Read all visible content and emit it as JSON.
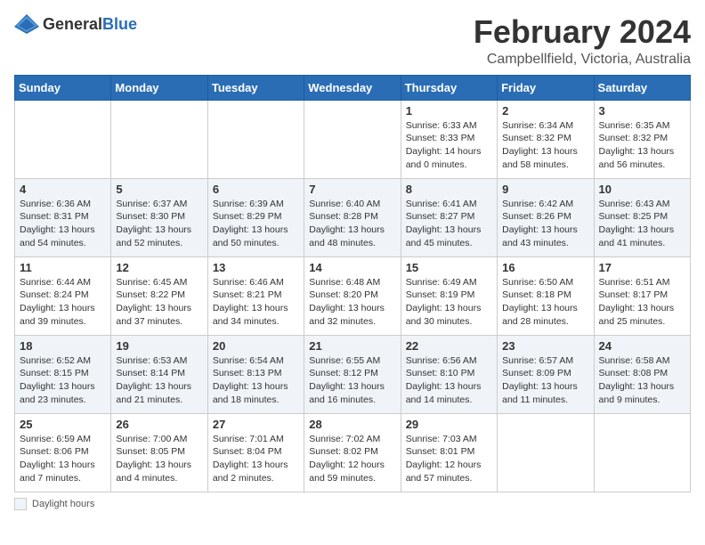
{
  "logo": {
    "text_general": "General",
    "text_blue": "Blue"
  },
  "header": {
    "month": "February 2024",
    "location": "Campbellfield, Victoria, Australia"
  },
  "days_of_week": [
    "Sunday",
    "Monday",
    "Tuesday",
    "Wednesday",
    "Thursday",
    "Friday",
    "Saturday"
  ],
  "weeks": [
    [
      {
        "num": "",
        "info": ""
      },
      {
        "num": "",
        "info": ""
      },
      {
        "num": "",
        "info": ""
      },
      {
        "num": "",
        "info": ""
      },
      {
        "num": "1",
        "info": "Sunrise: 6:33 AM\nSunset: 8:33 PM\nDaylight: 14 hours\nand 0 minutes."
      },
      {
        "num": "2",
        "info": "Sunrise: 6:34 AM\nSunset: 8:32 PM\nDaylight: 13 hours\nand 58 minutes."
      },
      {
        "num": "3",
        "info": "Sunrise: 6:35 AM\nSunset: 8:32 PM\nDaylight: 13 hours\nand 56 minutes."
      }
    ],
    [
      {
        "num": "4",
        "info": "Sunrise: 6:36 AM\nSunset: 8:31 PM\nDaylight: 13 hours\nand 54 minutes."
      },
      {
        "num": "5",
        "info": "Sunrise: 6:37 AM\nSunset: 8:30 PM\nDaylight: 13 hours\nand 52 minutes."
      },
      {
        "num": "6",
        "info": "Sunrise: 6:39 AM\nSunset: 8:29 PM\nDaylight: 13 hours\nand 50 minutes."
      },
      {
        "num": "7",
        "info": "Sunrise: 6:40 AM\nSunset: 8:28 PM\nDaylight: 13 hours\nand 48 minutes."
      },
      {
        "num": "8",
        "info": "Sunrise: 6:41 AM\nSunset: 8:27 PM\nDaylight: 13 hours\nand 45 minutes."
      },
      {
        "num": "9",
        "info": "Sunrise: 6:42 AM\nSunset: 8:26 PM\nDaylight: 13 hours\nand 43 minutes."
      },
      {
        "num": "10",
        "info": "Sunrise: 6:43 AM\nSunset: 8:25 PM\nDaylight: 13 hours\nand 41 minutes."
      }
    ],
    [
      {
        "num": "11",
        "info": "Sunrise: 6:44 AM\nSunset: 8:24 PM\nDaylight: 13 hours\nand 39 minutes."
      },
      {
        "num": "12",
        "info": "Sunrise: 6:45 AM\nSunset: 8:22 PM\nDaylight: 13 hours\nand 37 minutes."
      },
      {
        "num": "13",
        "info": "Sunrise: 6:46 AM\nSunset: 8:21 PM\nDaylight: 13 hours\nand 34 minutes."
      },
      {
        "num": "14",
        "info": "Sunrise: 6:48 AM\nSunset: 8:20 PM\nDaylight: 13 hours\nand 32 minutes."
      },
      {
        "num": "15",
        "info": "Sunrise: 6:49 AM\nSunset: 8:19 PM\nDaylight: 13 hours\nand 30 minutes."
      },
      {
        "num": "16",
        "info": "Sunrise: 6:50 AM\nSunset: 8:18 PM\nDaylight: 13 hours\nand 28 minutes."
      },
      {
        "num": "17",
        "info": "Sunrise: 6:51 AM\nSunset: 8:17 PM\nDaylight: 13 hours\nand 25 minutes."
      }
    ],
    [
      {
        "num": "18",
        "info": "Sunrise: 6:52 AM\nSunset: 8:15 PM\nDaylight: 13 hours\nand 23 minutes."
      },
      {
        "num": "19",
        "info": "Sunrise: 6:53 AM\nSunset: 8:14 PM\nDaylight: 13 hours\nand 21 minutes."
      },
      {
        "num": "20",
        "info": "Sunrise: 6:54 AM\nSunset: 8:13 PM\nDaylight: 13 hours\nand 18 minutes."
      },
      {
        "num": "21",
        "info": "Sunrise: 6:55 AM\nSunset: 8:12 PM\nDaylight: 13 hours\nand 16 minutes."
      },
      {
        "num": "22",
        "info": "Sunrise: 6:56 AM\nSunset: 8:10 PM\nDaylight: 13 hours\nand 14 minutes."
      },
      {
        "num": "23",
        "info": "Sunrise: 6:57 AM\nSunset: 8:09 PM\nDaylight: 13 hours\nand 11 minutes."
      },
      {
        "num": "24",
        "info": "Sunrise: 6:58 AM\nSunset: 8:08 PM\nDaylight: 13 hours\nand 9 minutes."
      }
    ],
    [
      {
        "num": "25",
        "info": "Sunrise: 6:59 AM\nSunset: 8:06 PM\nDaylight: 13 hours\nand 7 minutes."
      },
      {
        "num": "26",
        "info": "Sunrise: 7:00 AM\nSunset: 8:05 PM\nDaylight: 13 hours\nand 4 minutes."
      },
      {
        "num": "27",
        "info": "Sunrise: 7:01 AM\nSunset: 8:04 PM\nDaylight: 13 hours\nand 2 minutes."
      },
      {
        "num": "28",
        "info": "Sunrise: 7:02 AM\nSunset: 8:02 PM\nDaylight: 12 hours\nand 59 minutes."
      },
      {
        "num": "29",
        "info": "Sunrise: 7:03 AM\nSunset: 8:01 PM\nDaylight: 12 hours\nand 57 minutes."
      },
      {
        "num": "",
        "info": ""
      },
      {
        "num": "",
        "info": ""
      }
    ]
  ],
  "footer": {
    "square_label": "Daylight hours"
  }
}
